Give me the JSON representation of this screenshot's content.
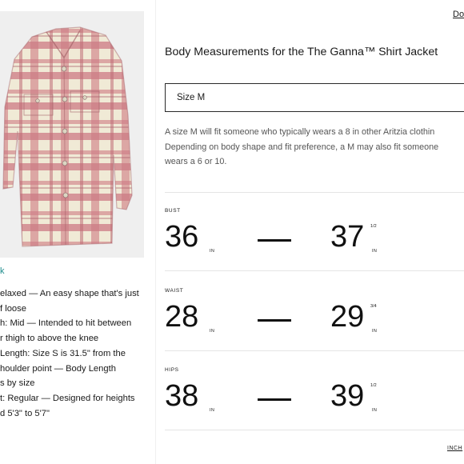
{
  "product_panel": {
    "fit_label": "k",
    "details": [
      "elaxed — An easy shape that's just",
      "f loose",
      "h: Mid — Intended to hit between",
      "r thigh to above the knee",
      "Length: Size S is 31.5\" from the",
      "houlder point — Body Length",
      "s by size",
      "t: Regular — Designed for heights",
      "d 5'3\" to 5'7\""
    ]
  },
  "modal": {
    "done_label": "Do",
    "title": "Body Measurements for the The Ganna™ Shirt Jacket",
    "size_select": {
      "value": "Size M"
    },
    "description_lines": [
      "A size M will fit someone who typically wears a 8 in other Aritzia clothin",
      "Depending on body shape and fit preference, a M may also fit someone",
      "wears a 6 or 10."
    ],
    "measurements": [
      {
        "label": "BUST",
        "min": "36",
        "min_unit": "IN",
        "max": "37",
        "max_fraction": "1/2",
        "max_unit": "IN"
      },
      {
        "label": "WAIST",
        "min": "28",
        "min_unit": "IN",
        "max": "29",
        "max_fraction": "3/4",
        "max_unit": "IN"
      },
      {
        "label": "HIPS",
        "min": "38",
        "min_unit": "IN",
        "max": "39",
        "max_fraction": "1/2",
        "max_unit": "IN"
      }
    ],
    "units_toggle": "INCH"
  },
  "colors": {
    "plaid_rose": "#c9707a",
    "plaid_cream": "#ece6cf",
    "accent_teal": "#1e8c8c"
  }
}
